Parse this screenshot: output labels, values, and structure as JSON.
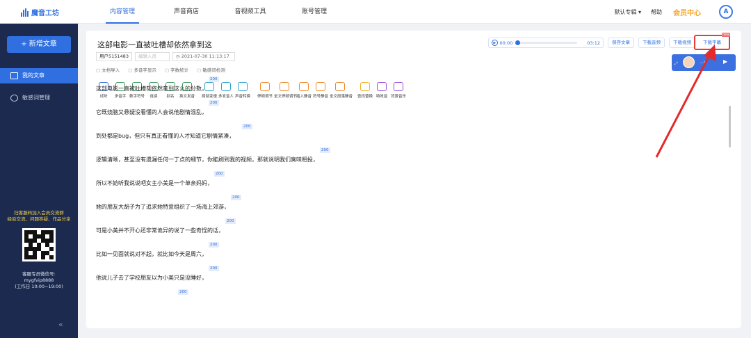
{
  "app": {
    "name": "魔音工坊"
  },
  "nav": {
    "items": [
      "内容管理",
      "声音商店",
      "音视频工具",
      "账号管理"
    ]
  },
  "top_right": {
    "album": "默认专辑",
    "help": "帮助",
    "vip": "会员中心",
    "avatar_text": "A"
  },
  "sidebar": {
    "new_button": "+ 新增文章",
    "items": [
      "我的文章",
      "敏感词管理"
    ],
    "promo": "扫客服码加入会员交流群\n经验交流、问题答疑、作品分享",
    "service": "客服专员微信号:\nmygfvip8888\n(工作日 10:00~19:00)",
    "collapse": "«"
  },
  "doc": {
    "title": "这部电影一直被吐槽却依然拿到这",
    "user": "用户5151483",
    "editor_placeholder": "编辑人员",
    "date": "2021-07-30 11:13:17",
    "tool_links": [
      "文档导入",
      "多音字显示",
      "字数统计",
      "敏感词检测"
    ]
  },
  "audio": {
    "current": "00:00",
    "duration": "03:12"
  },
  "actions": {
    "save": "保存文章",
    "download_audio": "下载音频",
    "download_video": "下载视频",
    "download_subtitle": "下载字幕",
    "badge": "new"
  },
  "player": {
    "label": "...x"
  },
  "tools": [
    {
      "label": "试听",
      "color": "#2f6fe0"
    },
    {
      "label": "多音字",
      "color": "#3a9b5d"
    },
    {
      "label": "数字符号",
      "color": "#3a9b5d"
    },
    {
      "label": "连读",
      "color": "#3a9b5d"
    },
    {
      "label": "别名",
      "color": "#3a9b5d"
    },
    {
      "label": "英文发音",
      "color": "#3a9b5d"
    },
    {
      "label": "局部变速",
      "color": "#2aa5c9"
    },
    {
      "label": "多发音人",
      "color": "#2aa5c9"
    },
    {
      "label": "声音转换",
      "color": "#2aa5c9"
    },
    {
      "label": "停顿调节",
      "color": "#f08a24"
    },
    {
      "label": "全文停顿调节",
      "color": "#f08a24"
    },
    {
      "label": "插入静音",
      "color": "#f08a24"
    },
    {
      "label": "符号静音",
      "color": "#f08a24"
    },
    {
      "label": "全文段落静音",
      "color": "#f08a24"
    },
    {
      "label": "查找替换",
      "color": "#f0b424"
    },
    {
      "label": "特效音",
      "color": "#9b4fd6"
    },
    {
      "label": "背景音乐",
      "color": "#9b4fd6"
    }
  ],
  "lines": [
    {
      "text": "这部电影一直被吐槽却依然拿到这么的分数，",
      "tag": "200"
    },
    {
      "text": "它既烧脑又悬疑没看懂的人会说他剧情混乱，",
      "tag": "200"
    },
    {
      "text": "到处都是bug，但只有真正看懂的人才知道它剧情紧凑，",
      "tag": "200"
    },
    {
      "text": "逻辑清晰，甚至没有遗漏任何一丁点的细节，你能刷到我的视频，那就说明我们臭味相投，",
      "tag": "200"
    },
    {
      "text": "所以不妨听我说说吧女主小美是一个单亲妈妈，",
      "tag": "200"
    },
    {
      "text": "她的朋友大胡子为了追求她特意组织了一场海上郊游，",
      "tag": "200"
    },
    {
      "text": "可是小美并不开心还非常诡异的说了一些奇怪的话，",
      "tag": "200"
    },
    {
      "text": "比如一见面就说对不起，就比如今天是周六，",
      "tag": "200"
    },
    {
      "text": "他说儿子去了学校朋友以为小美只是没睡好，",
      "tag": "200"
    },
    {
      "text": "",
      "tag": "200"
    }
  ]
}
